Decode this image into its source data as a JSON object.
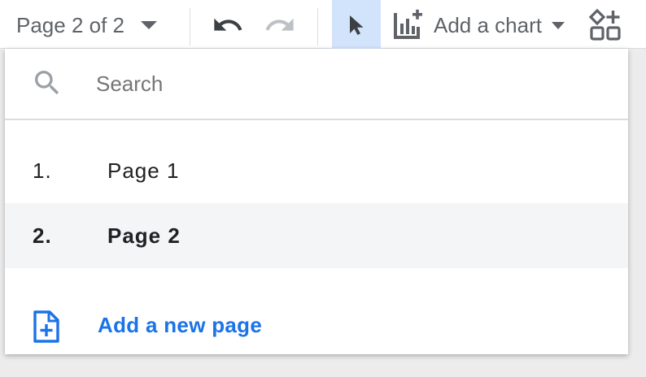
{
  "toolbar": {
    "page_select_label": "Page 2 of 2",
    "add_chart_label": "Add a chart",
    "icons": {
      "page_select": "dropdown-caret",
      "undo": "undo-arrow",
      "redo": "redo-arrow",
      "select": "pointer-arrow",
      "add_chart": "bar-chart-plus",
      "add_control": "shapes-plus"
    }
  },
  "page_menu": {
    "search_placeholder": "Search",
    "pages": [
      {
        "number": "1.",
        "name": "Page 1",
        "active": false
      },
      {
        "number": "2.",
        "name": "Page 2",
        "active": true
      }
    ],
    "add_page_label": "Add a new page"
  },
  "colors": {
    "accent": "#1a73e8",
    "selected_tool_bg": "#d2e3fc",
    "active_row_bg": "#f4f5f6",
    "icon_gray": "#5f6368"
  }
}
